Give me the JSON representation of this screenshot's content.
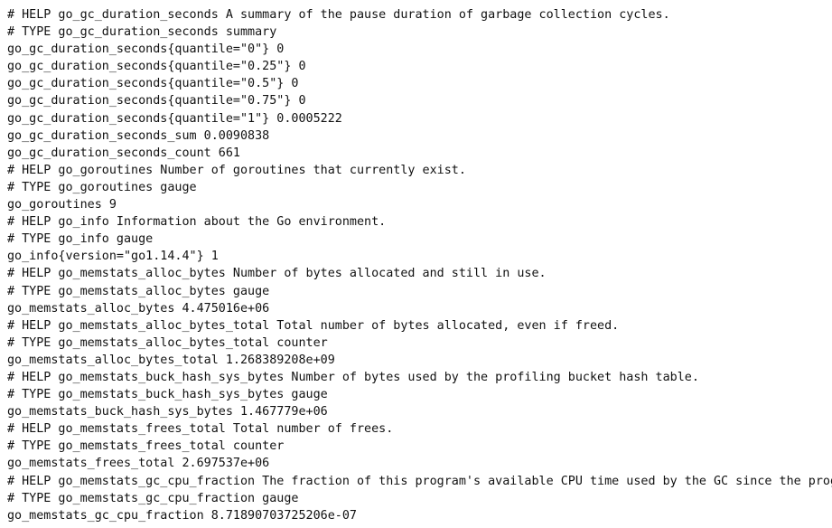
{
  "metrics_text": {
    "lines": [
      "# HELP go_gc_duration_seconds A summary of the pause duration of garbage collection cycles.",
      "# TYPE go_gc_duration_seconds summary",
      "go_gc_duration_seconds{quantile=\"0\"} 0",
      "go_gc_duration_seconds{quantile=\"0.25\"} 0",
      "go_gc_duration_seconds{quantile=\"0.5\"} 0",
      "go_gc_duration_seconds{quantile=\"0.75\"} 0",
      "go_gc_duration_seconds{quantile=\"1\"} 0.0005222",
      "go_gc_duration_seconds_sum 0.0090838",
      "go_gc_duration_seconds_count 661",
      "# HELP go_goroutines Number of goroutines that currently exist.",
      "# TYPE go_goroutines gauge",
      "go_goroutines 9",
      "# HELP go_info Information about the Go environment.",
      "# TYPE go_info gauge",
      "go_info{version=\"go1.14.4\"} 1",
      "# HELP go_memstats_alloc_bytes Number of bytes allocated and still in use.",
      "# TYPE go_memstats_alloc_bytes gauge",
      "go_memstats_alloc_bytes 4.475016e+06",
      "# HELP go_memstats_alloc_bytes_total Total number of bytes allocated, even if freed.",
      "# TYPE go_memstats_alloc_bytes_total counter",
      "go_memstats_alloc_bytes_total 1.268389208e+09",
      "# HELP go_memstats_buck_hash_sys_bytes Number of bytes used by the profiling bucket hash table.",
      "# TYPE go_memstats_buck_hash_sys_bytes gauge",
      "go_memstats_buck_hash_sys_bytes 1.467779e+06",
      "# HELP go_memstats_frees_total Total number of frees.",
      "# TYPE go_memstats_frees_total counter",
      "go_memstats_frees_total 2.697537e+06",
      "# HELP go_memstats_gc_cpu_fraction The fraction of this program's available CPU time used by the GC since the prog",
      "# TYPE go_memstats_gc_cpu_fraction gauge",
      "go_memstats_gc_cpu_fraction 8.71890703725206e-07"
    ]
  }
}
